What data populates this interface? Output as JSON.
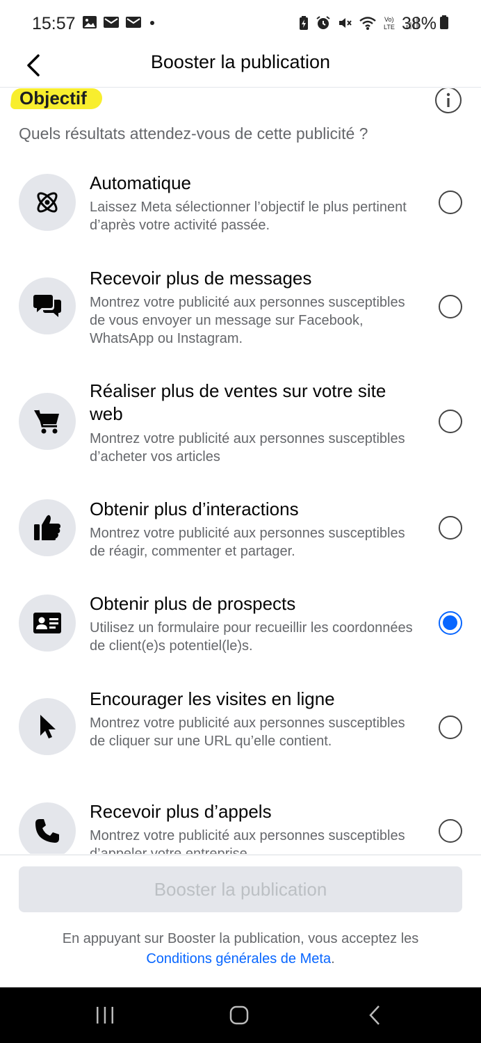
{
  "status_bar": {
    "time": "15:57",
    "battery": "38%",
    "left_icons": [
      "gallery-icon",
      "mail-icon",
      "mail-icon",
      "dot-icon"
    ],
    "right_icons": [
      "battery-saver-icon",
      "alarm-icon",
      "mute-icon",
      "wifi-icon",
      "volte-icon",
      "signal-icon"
    ]
  },
  "header": {
    "title": "Booster la publication"
  },
  "section": {
    "title": "Objectif",
    "subtitle": "Quels résultats attendez-vous de cette publicité ?",
    "highlight_color": "#f8ee2e"
  },
  "options": [
    {
      "icon": "atom-icon",
      "title": "Automatique",
      "description": "Laissez Meta sélectionner l’objectif le plus pertinent d’après votre activité passée.",
      "selected": false
    },
    {
      "icon": "chat-bubbles-icon",
      "title": "Recevoir plus de messages",
      "description": "Montrez votre publicité aux personnes susceptibles de vous envoyer un message sur Facebook, WhatsApp ou Instagram.",
      "selected": false
    },
    {
      "icon": "shopping-cart-icon",
      "title": "Réaliser plus de ventes sur votre site web",
      "description": "Montrez votre publicité aux personnes susceptibles d’acheter vos articles",
      "selected": false
    },
    {
      "icon": "thumbs-up-icon",
      "title": "Obtenir plus d’interactions",
      "description": "Montrez votre publicité aux personnes susceptibles de réagir, commenter et partager.",
      "selected": false
    },
    {
      "icon": "contact-card-icon",
      "title": "Obtenir plus de prospects",
      "description": "Utilisez un formulaire pour recueillir les coordonnées de client(e)s potentiel(le)s.",
      "selected": true
    },
    {
      "icon": "cursor-icon",
      "title": "Encourager les visites en ligne",
      "description": "Montrez votre publicité aux personnes susceptibles de cliquer sur une URL qu’elle contient.",
      "selected": false
    },
    {
      "icon": "phone-icon",
      "title": "Recevoir plus d’appels",
      "description": "Montrez votre publicité aux personnes susceptibles d’appeler votre entreprise.",
      "selected": false
    }
  ],
  "footer": {
    "button_label": "Booster la publication",
    "terms_text": "En appuyant sur Booster la publication, vous acceptez les",
    "terms_link": "Conditions générales de Meta",
    "terms_end": "."
  },
  "colors": {
    "accent": "#0866ff",
    "muted_text": "#65676b",
    "icon_bg": "#e4e6eb",
    "disabled_text": "#bcc0c4"
  }
}
